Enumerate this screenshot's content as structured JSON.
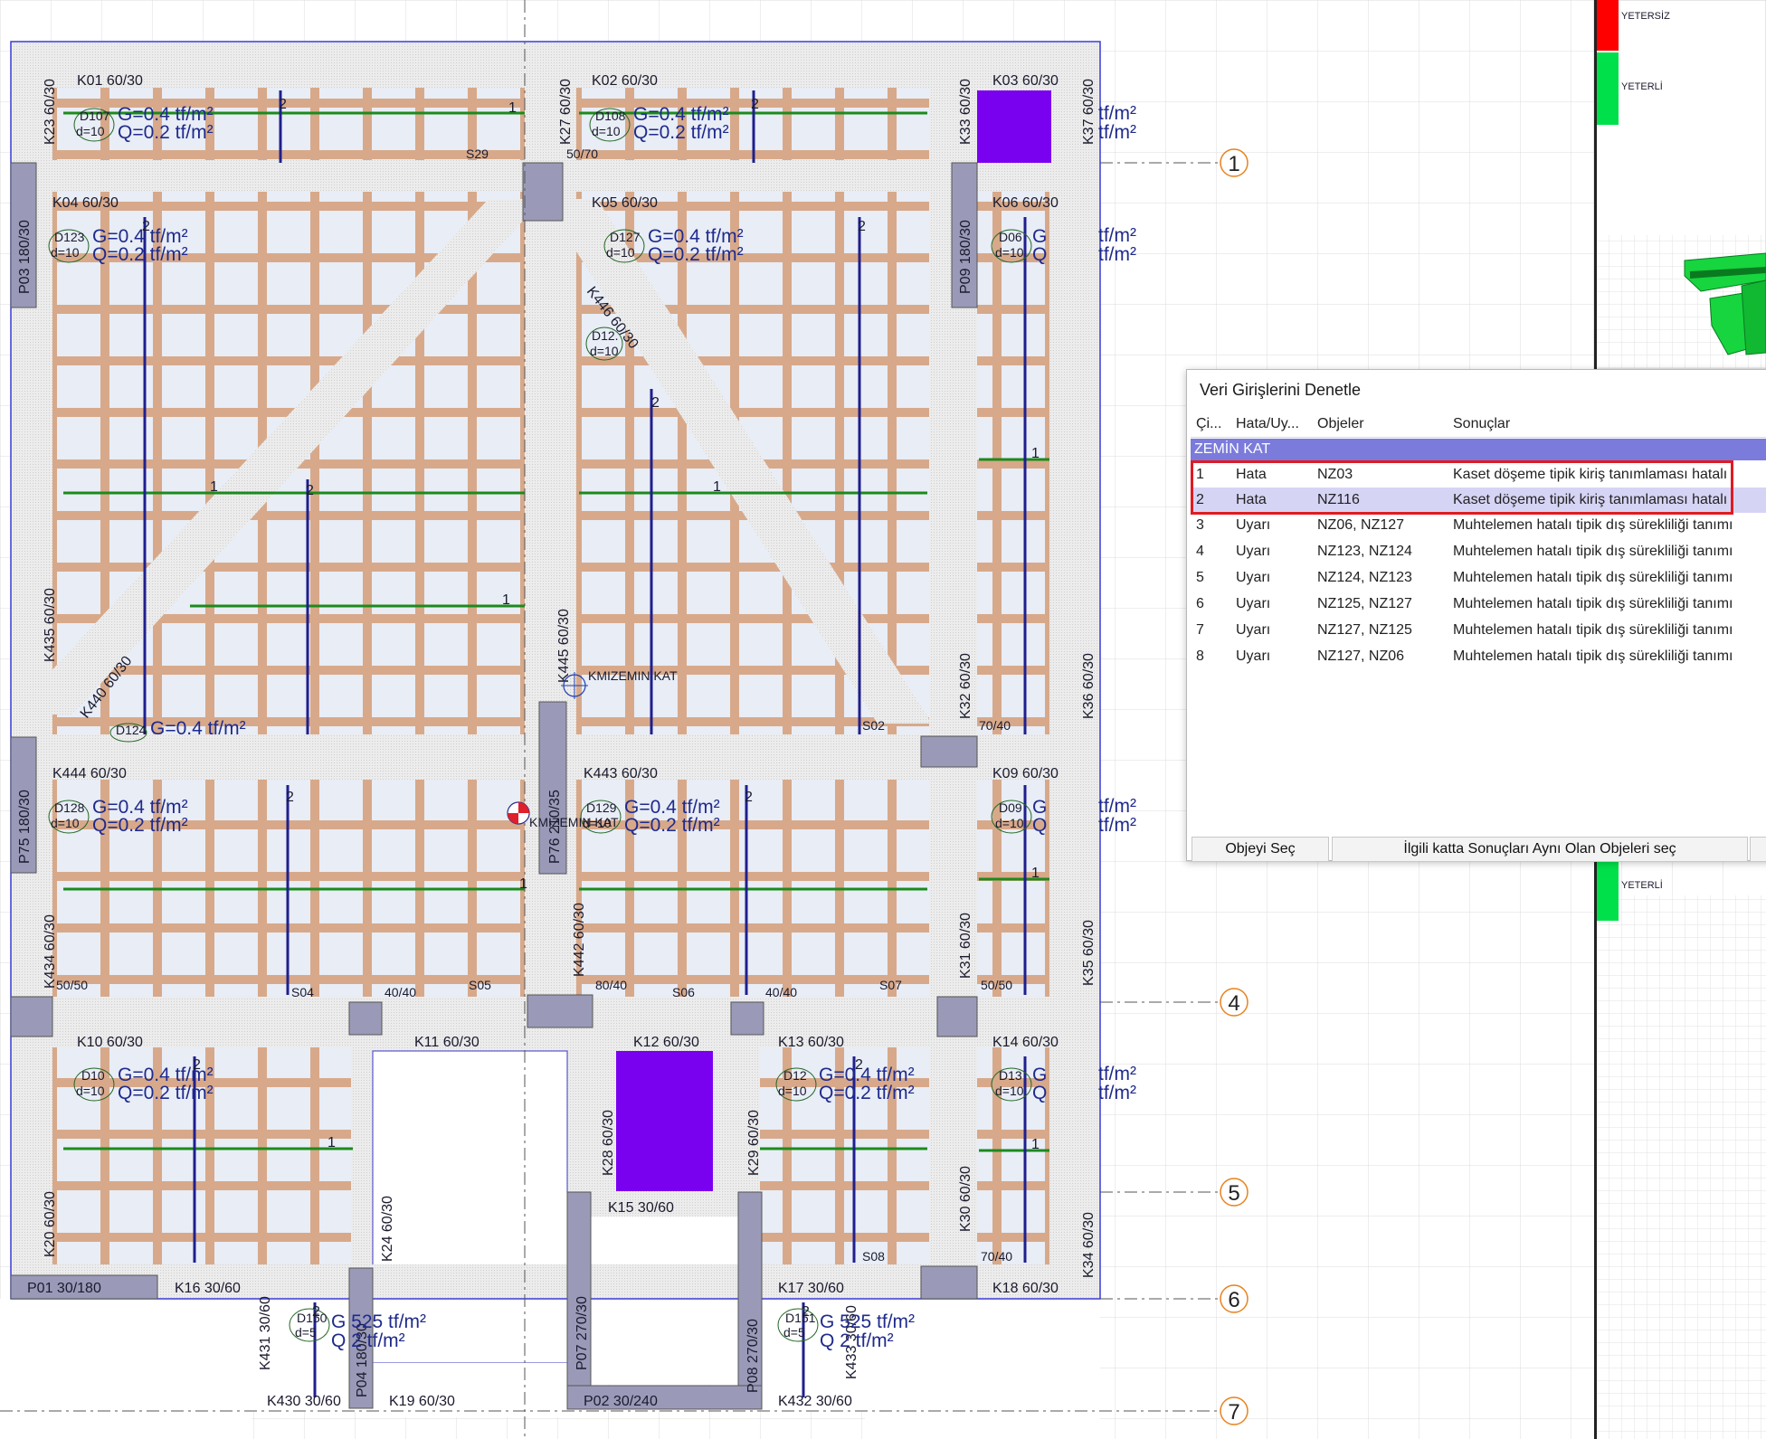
{
  "legend": {
    "bad_label": "YETERSİZ",
    "good_label": "YETERLİ",
    "good_label_2": "YETERLİ",
    "bad_color": "#ff0000",
    "good_color": "#00e04a"
  },
  "axis_bubbles": [
    "1",
    "4",
    "5",
    "6",
    "7"
  ],
  "beams": {
    "k01": "K01 60/30",
    "k02": "K02 60/30",
    "k03": "K03 60/30",
    "k04": "K04 60/30",
    "k05": "K05 60/30",
    "k06": "K06 60/30",
    "k444": "K444 60/30",
    "k443": "K443 60/30",
    "k09": "K09 60/30",
    "k10": "K10 60/30",
    "k11": "K11 60/30",
    "k12": "K12 60/30",
    "k13": "K13 60/30",
    "k14": "K14 60/30",
    "k16": "K16 30/60",
    "k17": "K17 30/60",
    "k18": "K18 60/30",
    "k15": "K15 30/60",
    "k19": "K19 60/30",
    "k430": "K430 30/60",
    "k432": "K432 30/60",
    "k23": "K23 60/30",
    "k27": "K27 60/30",
    "k33": "K33 60/30",
    "k37": "K37 60/30",
    "k435": "K435 60/30",
    "k440": "K440 60/30",
    "k446": "K446 60/30",
    "k445": "K445 60/30",
    "k32": "K32 60/30",
    "k36": "K36 60/30",
    "k434": "K434 60/30",
    "k442": "K442 60/30",
    "k31": "K31 60/30",
    "k35": "K35 60/30",
    "k20": "K20 60/30",
    "k24": "K24 60/30",
    "k28": "K28 60/30",
    "k29": "K29 60/30",
    "k30": "K30 60/30",
    "k34": "K34 60/30",
    "k431": "K431 30/60",
    "k433": "K433 30/60"
  },
  "columns": {
    "p03": "P03 180/30",
    "p09": "P09 180/30",
    "p75": "P75 180/30",
    "p76": "P76 210/35",
    "p01": "P01 30/180",
    "p04": "P04 180/30",
    "p07": "P07 270/30",
    "p08": "P08 270/30",
    "p02": "P02 30/240"
  },
  "panels": {
    "s29": "S29",
    "s02": "S02",
    "s04": "S04",
    "s05": "S05",
    "s06": "S06",
    "s07": "S07",
    "s08": "S08",
    "c5070": "50/70",
    "c7040a": "70/40",
    "c5050a": "50/50",
    "c4040a": "40/40",
    "c8040": "80/40",
    "c4040b": "40/40",
    "c5050b": "50/50",
    "c7040b": "70/40"
  },
  "slabs": {
    "d107": "D107",
    "d108": "D108",
    "d123": "D123",
    "d127": "D127",
    "d06": "D06",
    "d12x": "D12.",
    "d128": "D128",
    "d129": "D129",
    "d09": "D09",
    "d10": "D10",
    "d12": "D12",
    "d13": "D13",
    "d150": "D150",
    "d151": "D151",
    "d124": "D124",
    "thick": "d=10",
    "thick_b": "d=5",
    "load_g": "G=0.4 tf/m²",
    "load_q": "Q=0.2 tf/m²",
    "load_g_b": "G=0.4 tf/m²",
    "load_g2": "G=0.525 tf/m²",
    "load_q2": "Q=0.2 tf/m²",
    "load_g2_frag": "G 525 tf/m²",
    "load_q2_frag": "Q 2 tf/m²",
    "load_unit_frag": "tf/m²",
    "load_unit_frag_p": "tf/m²",
    "load_g_partial": "G",
    "load_q_partial": "Q"
  },
  "dims": {
    "one": "1",
    "two": "2"
  },
  "markers": {
    "story_label": "KMIZEMIN KAT"
  },
  "dialog": {
    "title": "Veri Girişlerini Denetle",
    "columns": [
      "Çi...",
      "Hata/Uy...",
      "Objeler",
      "Sonuçlar"
    ],
    "group": "ZEMİN KAT",
    "rows": [
      {
        "no": "1",
        "type": "Hata",
        "objects": "NZ03",
        "result": "Kaset döşeme tipik kiriş tanımlaması hatalı"
      },
      {
        "no": "2",
        "type": "Hata",
        "objects": "NZ116",
        "result": "Kaset döşeme tipik kiriş tanımlaması hatalı"
      },
      {
        "no": "3",
        "type": "Uyarı",
        "objects": "NZ06, NZ127",
        "result": "Muhtelemen hatalı tipik dış sürekliliği tanımı"
      },
      {
        "no": "4",
        "type": "Uyarı",
        "objects": "NZ123, NZ124",
        "result": "Muhtelemen hatalı tipik dış sürekliliği tanımı"
      },
      {
        "no": "5",
        "type": "Uyarı",
        "objects": "NZ124, NZ123",
        "result": "Muhtelemen hatalı tipik dış sürekliliği tanımı"
      },
      {
        "no": "6",
        "type": "Uyarı",
        "objects": "NZ125, NZ127",
        "result": "Muhtelemen hatalı tipik dış sürekliliği tanımı"
      },
      {
        "no": "7",
        "type": "Uyarı",
        "objects": "NZ127, NZ125",
        "result": "Muhtelemen hatalı tipik dış sürekliliği tanımı"
      },
      {
        "no": "8",
        "type": "Uyarı",
        "objects": "NZ127, NZ06",
        "result": "Muhtelemen hatalı tipik dış sürekliliği tanımı"
      }
    ],
    "selected_row": 2,
    "btn_select": "Objeyi Seç",
    "btn_select_same": "İlgili katta Sonuçları Aynı Olan Objeleri seç"
  }
}
